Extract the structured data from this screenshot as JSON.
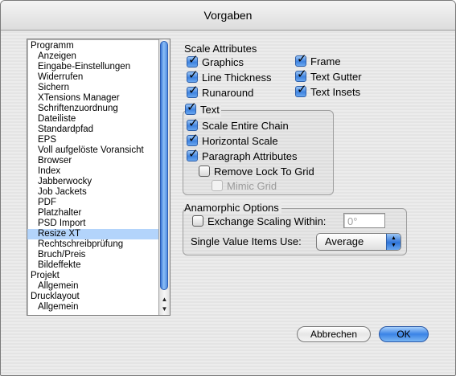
{
  "window": {
    "title": "Vorgaben"
  },
  "sidebar": {
    "items": [
      {
        "label": "Programm",
        "level": "cat"
      },
      {
        "label": "Anzeigen",
        "level": "sub"
      },
      {
        "label": "Eingabe-Einstellungen",
        "level": "sub"
      },
      {
        "label": "Widerrufen",
        "level": "sub"
      },
      {
        "label": "Sichern",
        "level": "sub"
      },
      {
        "label": "XTensions Manager",
        "level": "sub"
      },
      {
        "label": "Schriftenzuordnung",
        "level": "sub"
      },
      {
        "label": "Dateiliste",
        "level": "sub"
      },
      {
        "label": "Standardpfad",
        "level": "sub"
      },
      {
        "label": "EPS",
        "level": "sub"
      },
      {
        "label": "Voll aufgelöste Voransicht",
        "level": "sub"
      },
      {
        "label": "Browser",
        "level": "sub"
      },
      {
        "label": "Index",
        "level": "sub"
      },
      {
        "label": "Jabberwocky",
        "level": "sub"
      },
      {
        "label": "Job Jackets",
        "level": "sub"
      },
      {
        "label": "PDF",
        "level": "sub"
      },
      {
        "label": "Platzhalter",
        "level": "sub"
      },
      {
        "label": "PSD Import",
        "level": "sub"
      },
      {
        "label": "Resize XT",
        "level": "sub",
        "selected": true
      },
      {
        "label": "Rechtschreibprüfung",
        "level": "sub"
      },
      {
        "label": "Bruch/Preis",
        "level": "sub"
      },
      {
        "label": "Bildeffekte",
        "level": "sub"
      },
      {
        "label": "Projekt",
        "level": "cat"
      },
      {
        "label": "Allgemein",
        "level": "sub"
      },
      {
        "label": "Drucklayout",
        "level": "cat"
      },
      {
        "label": "Allgemein",
        "level": "sub"
      }
    ]
  },
  "scale_attributes": {
    "heading": "Scale Attributes",
    "graphics": {
      "label": "Graphics",
      "checked": true
    },
    "line_thickness": {
      "label": "Line Thickness",
      "checked": true
    },
    "runaround": {
      "label": "Runaround",
      "checked": true
    },
    "frame": {
      "label": "Frame",
      "checked": true
    },
    "text_gutter": {
      "label": "Text Gutter",
      "checked": true
    },
    "text_insets": {
      "label": "Text Insets",
      "checked": true
    }
  },
  "text_group": {
    "text": {
      "label": "Text",
      "checked": true
    },
    "scale_entire_chain": {
      "label": "Scale Entire Chain",
      "checked": true
    },
    "horizontal_scale": {
      "label": "Horizontal Scale",
      "checked": true
    },
    "paragraph_attributes": {
      "label": "Paragraph Attributes",
      "checked": true
    },
    "remove_lock_to_grid": {
      "label": "Remove Lock To Grid",
      "checked": false
    },
    "mimic_grid": {
      "label": "Mimic Grid",
      "checked": false,
      "disabled": true
    }
  },
  "anamorphic": {
    "heading": "Anamorphic Options",
    "exchange_scaling": {
      "label": "Exchange Scaling Within:",
      "checked": false
    },
    "angle_value": "0°",
    "single_value_label": "Single Value Items Use:",
    "single_value_selected": "Average"
  },
  "buttons": {
    "cancel": "Abbrechen",
    "ok": "OK"
  }
}
